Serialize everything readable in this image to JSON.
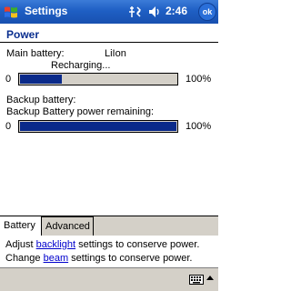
{
  "titlebar": {
    "title": "Settings",
    "time": "2:46",
    "ok_label": "ok",
    "icons": [
      "windows-start-icon",
      "connectivity-icon",
      "volume-icon"
    ]
  },
  "page": {
    "heading": "Power"
  },
  "main_battery": {
    "label": "Main battery:",
    "type": "LiIon",
    "status": "Recharging...",
    "bar_start": "0",
    "bar_end": "100%",
    "level_percent": 27
  },
  "backup_battery": {
    "label": "Backup battery:",
    "remaining_label": "Backup Battery power remaining:",
    "bar_start": "0",
    "bar_end": "100%",
    "level_percent": 100
  },
  "tabs": [
    {
      "label": "Battery",
      "active": true
    },
    {
      "label": "Advanced",
      "active": false
    }
  ],
  "footer": {
    "line1_pre": "Adjust ",
    "line1_link": "backlight",
    "line1_post": " settings to conserve power.",
    "line2_pre": "Change ",
    "line2_link": "beam",
    "line2_post": " settings to conserve power."
  },
  "menubar": {
    "icons": [
      "keyboard-icon",
      "input-menu-arrow-icon"
    ]
  },
  "colors": {
    "titlebar": "#1f5fc4",
    "heading": "#0a2f8f",
    "bar_fill": "#0a2a8a",
    "link": "#0000cc"
  }
}
